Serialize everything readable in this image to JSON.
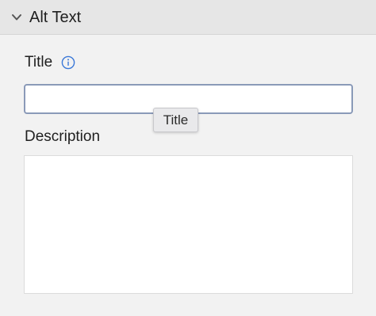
{
  "section": {
    "title": "Alt Text",
    "chevron_icon": "chevron-down-icon"
  },
  "title_field": {
    "label": "Title",
    "info_icon": "info-icon",
    "value": "",
    "placeholder": "",
    "tooltip": "Title"
  },
  "description_field": {
    "label": "Description",
    "value": "",
    "placeholder": ""
  },
  "colors": {
    "panel_background": "#f2f2f2",
    "header_background": "#e6e6e6",
    "focus_border": "#8a9ab8",
    "info_icon": "#3a78d8"
  }
}
